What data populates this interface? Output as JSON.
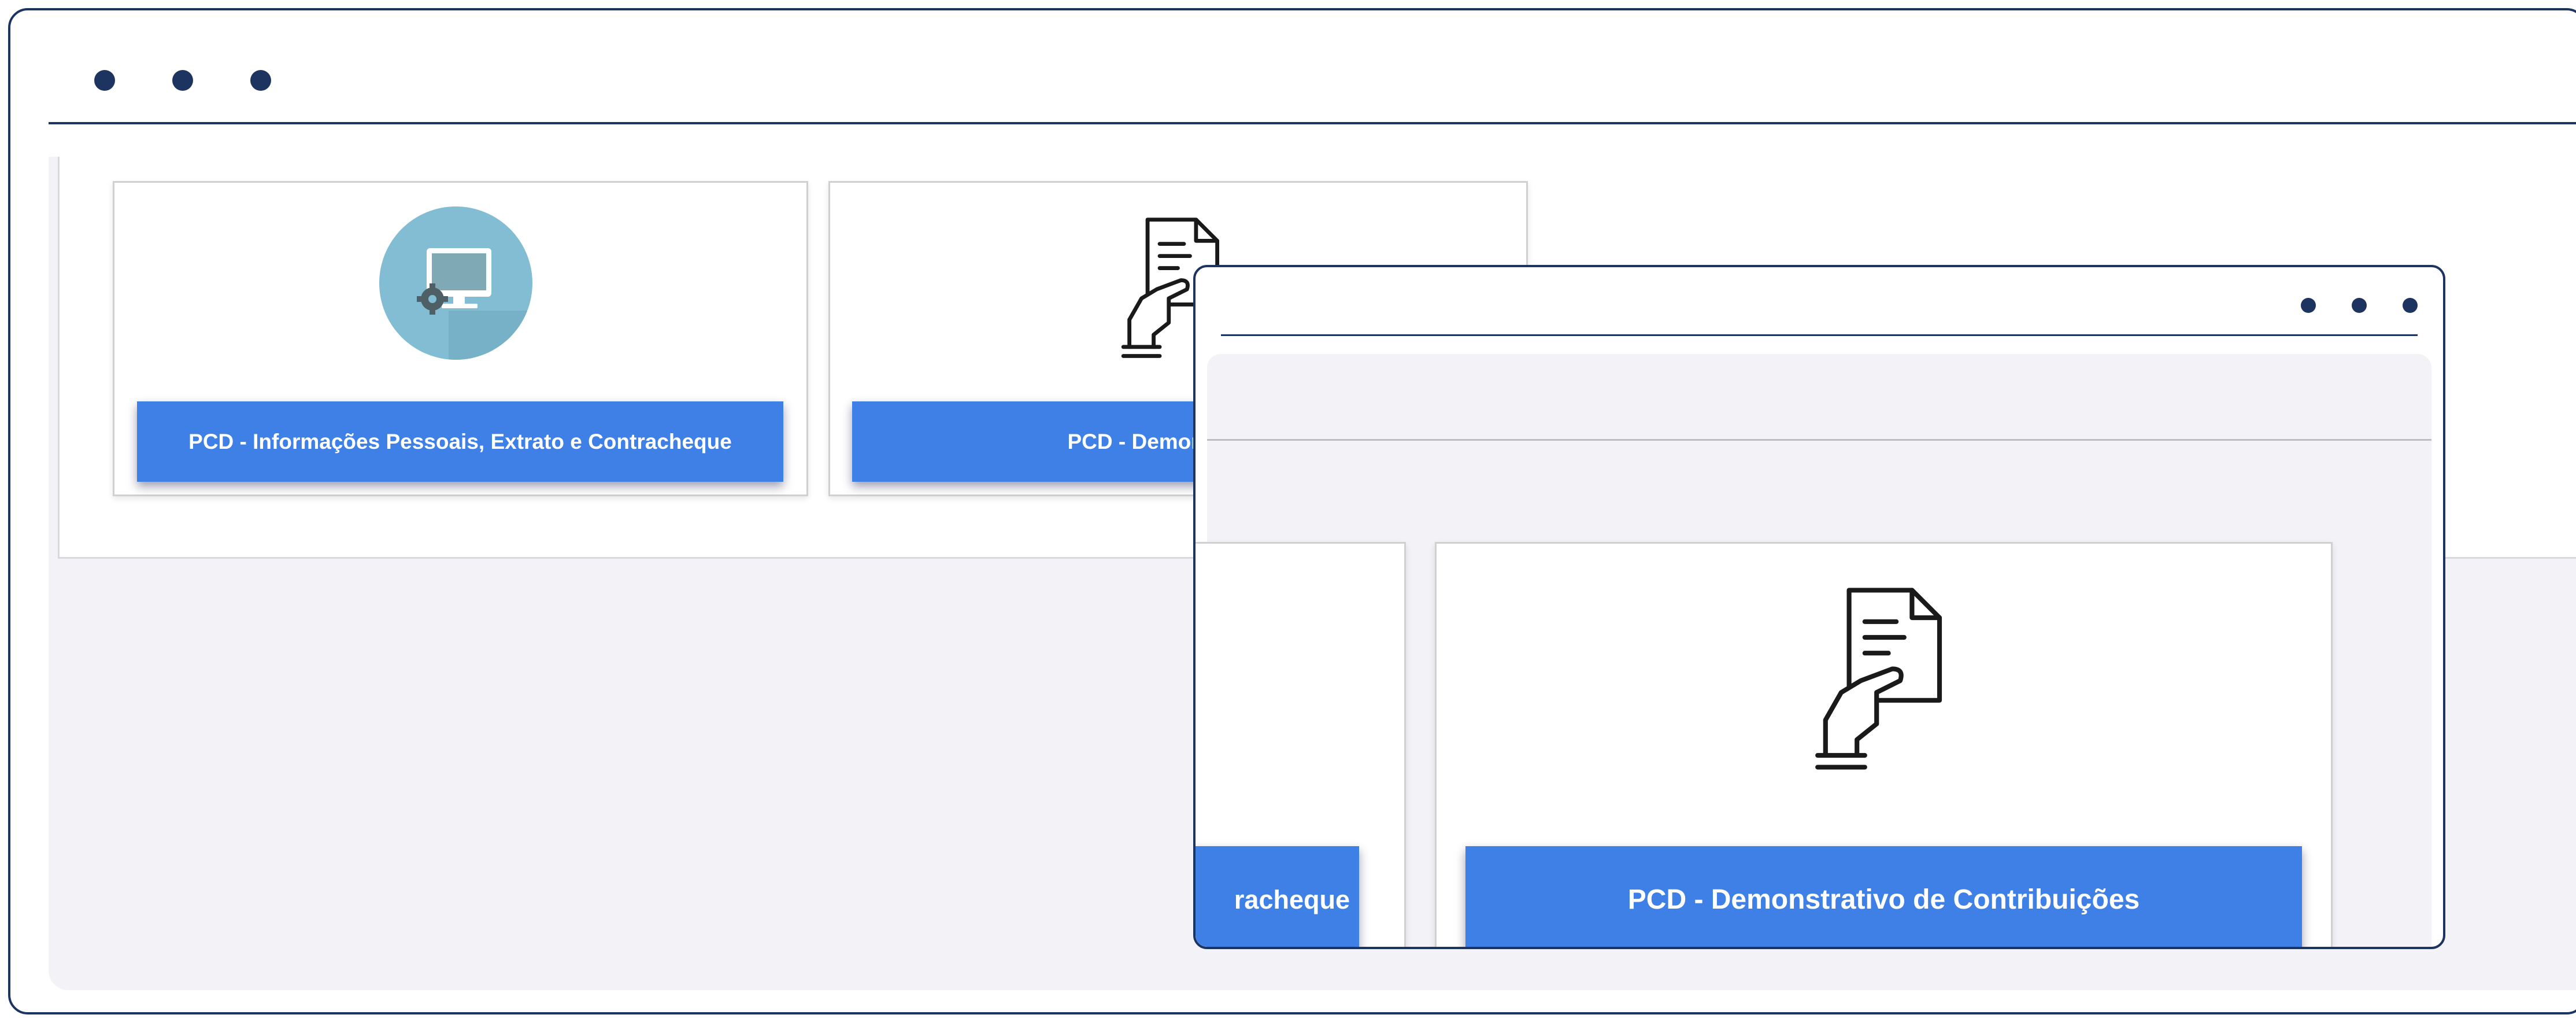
{
  "window_main": {
    "controls": [
      "dot-1",
      "dot-2",
      "dot-3"
    ],
    "cards": [
      {
        "label": "PCD - Informações Pessoais, Extrato e Contracheque",
        "icon": "computer-settings-icon"
      },
      {
        "label": "PCD - Demonstrativo",
        "icon": "document-hand-icon"
      }
    ]
  },
  "window_zoom": {
    "controls": [
      "dot-1",
      "dot-2",
      "dot-3"
    ],
    "cards": [
      {
        "label": "racheque",
        "icon": ""
      },
      {
        "label": "PCD - Demonstrativo de Contribuições",
        "icon": "document-hand-icon"
      }
    ]
  },
  "colors": {
    "frame": "#1d3461",
    "button": "#3f80e6",
    "icon_circle": "#82bdd3",
    "panel_gray": "#f2f2f7"
  }
}
